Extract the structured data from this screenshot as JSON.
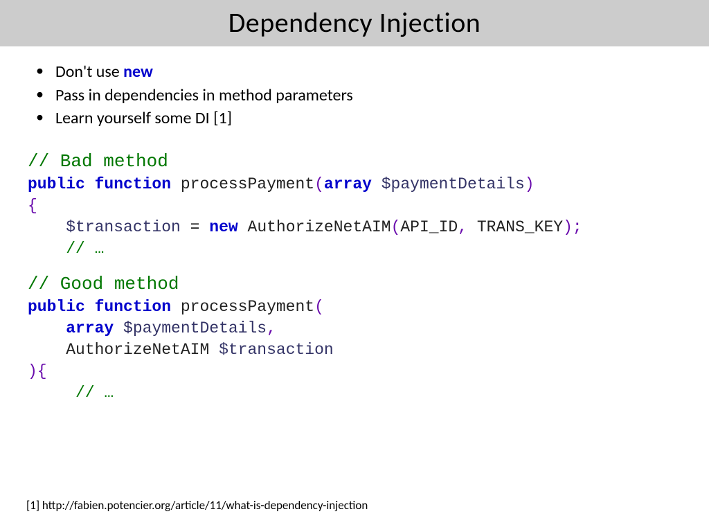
{
  "title": "Dependency Injection",
  "bullets": [
    {
      "pre": "Don't use ",
      "kw": "new",
      "post": ""
    },
    {
      "pre": "Pass in dependencies in method parameters",
      "kw": "",
      "post": ""
    },
    {
      "pre": "Learn yourself some DI [1]",
      "kw": "",
      "post": ""
    }
  ],
  "code": {
    "bad_comment": "// Bad method",
    "good_comment": "// Good method",
    "public_function": "public function",
    "processPayment": "processPayment",
    "array": "array",
    "paymentDetails": "$paymentDetails",
    "transaction_var": "$transaction",
    "new": "new",
    "AuthorizeNetAIM": "AuthorizeNetAIM",
    "api_id": "API_ID",
    "trans_key": "TRANS_KEY",
    "ellipsis": "// …",
    "lparen": "(",
    "rparen": ")",
    "lbrace": "{",
    "rbrace": "}",
    "comma": ",",
    "semi": ";",
    "eq": " = ",
    "rparen_brace": "){"
  },
  "footnote": "[1] http://fabien.potencier.org/article/11/what-is-dependency-injection"
}
